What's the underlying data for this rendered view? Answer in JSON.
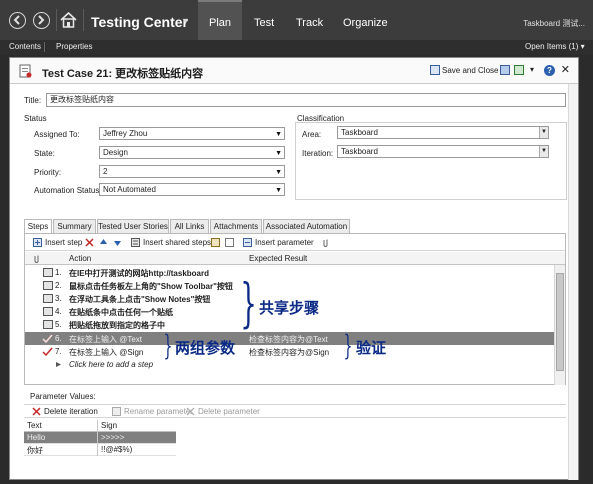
{
  "topbar": {
    "app_title": "Testing Center",
    "tabs": [
      "Plan",
      "Test",
      "Track",
      "Organize"
    ],
    "active_tab": "Plan",
    "user": "Taskboard 测试..."
  },
  "subbar": {
    "contents": "Contents",
    "properties": "Properties",
    "open_items": "Open Items (1) ▾"
  },
  "titlebar": {
    "title": "Test Case 21: 更改标签贴纸内容",
    "save_close": "Save and Close",
    "help": "?",
    "close": "✕"
  },
  "form": {
    "title_label": "Title:",
    "title_value": "更改标签贴纸内容",
    "status_group": "Status",
    "classification_group": "Classification",
    "assigned_to_label": "Assigned To:",
    "assigned_to_value": "Jeffrey Zhou",
    "state_label": "State:",
    "state_value": "Design",
    "priority_label": "Priority:",
    "priority_value": "2",
    "automation_label": "Automation Status:",
    "automation_value": "Not Automated",
    "area_label": "Area:",
    "area_value": "Taskboard",
    "iteration_label": "Iteration:",
    "iteration_value": "Taskboard"
  },
  "tabs": [
    "Steps",
    "Summary",
    "Tested User Stories",
    "All Links",
    "Attachments",
    "Associated Automation"
  ],
  "steps": {
    "toolbar": {
      "insert_step": "Insert step",
      "insert_shared": "Insert shared steps",
      "insert_parameter": "Insert parameter"
    },
    "columns": {
      "action": "Action",
      "expected": "Expected Result"
    },
    "rows": [
      {
        "num": "1.",
        "action": "在IE中打开测试的网站http://taskboard",
        "expected": ""
      },
      {
        "num": "2.",
        "action": "鼠标点击任务板左上角的\"Show Toolbar\"按钮",
        "expected": ""
      },
      {
        "num": "3.",
        "action": "在浮动工具条上点击\"Show Notes\"按钮",
        "expected": ""
      },
      {
        "num": "4.",
        "action": "在贴纸条中点击任何一个贴纸",
        "expected": ""
      },
      {
        "num": "5.",
        "action": "把贴纸拖放到指定的格子中",
        "expected": ""
      },
      {
        "num": "6.",
        "action": "在标签上输入 @Text",
        "expected": "检查标签内容为@Text"
      },
      {
        "num": "7.",
        "action": "在标签上输入 @Sign",
        "expected": "检查标签内容为@Sign"
      }
    ],
    "add_hint": "Click here to add a step"
  },
  "annotations": {
    "shared": "共享步骤",
    "params": "两组参数",
    "verify": "验证"
  },
  "params": {
    "label": "Parameter Values:",
    "delete_iteration": "Delete iteration",
    "rename_parameter": "Rename parameter",
    "delete_parameter": "Delete parameter",
    "columns": [
      "Text",
      "Sign"
    ],
    "rows": [
      [
        "Hello",
        ">>>>>"
      ],
      [
        "你好",
        "!!@#$%)"
      ]
    ]
  }
}
